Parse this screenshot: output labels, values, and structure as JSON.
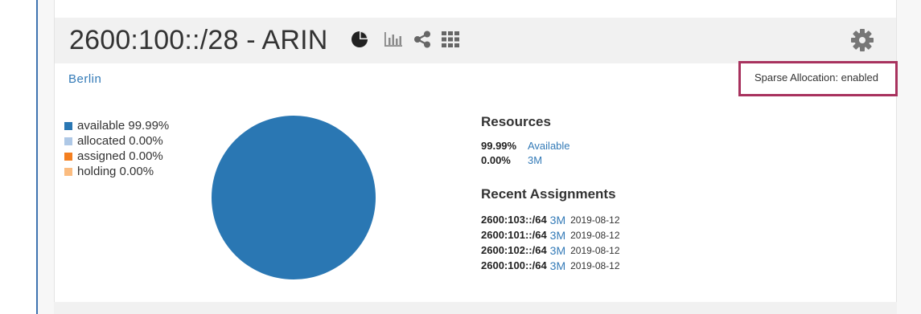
{
  "panel": {
    "title": "2600:100::/28 - ARIN",
    "location_link": "Berlin",
    "sparse_allocation": "Sparse Allocation: enabled",
    "header_icons": [
      "pie-chart-icon",
      "bar-chart-icon",
      "share-icon",
      "grid-icon",
      "gear-icon"
    ]
  },
  "legend": [
    {
      "label": "available 99.99%",
      "color": "#2a77b3"
    },
    {
      "label": "allocated 0.00%",
      "color": "#aec8e6"
    },
    {
      "label": "assigned 0.00%",
      "color": "#f47f20"
    },
    {
      "label": "holding 0.00%",
      "color": "#fbbc80"
    }
  ],
  "chart_data": {
    "type": "pie",
    "labels": [
      "available",
      "allocated",
      "assigned",
      "holding"
    ],
    "values": [
      99.99,
      0.0,
      0.0,
      0.0
    ],
    "colors": [
      "#2a77b3",
      "#aec8e6",
      "#f47f20",
      "#fbbc80"
    ]
  },
  "resources": {
    "title": "Resources",
    "rows": [
      {
        "pct": "99.99%",
        "label": "Available"
      },
      {
        "pct": "0.00%",
        "label": "3M"
      }
    ]
  },
  "recent": {
    "title": "Recent Assignments",
    "rows": [
      {
        "prefix": "2600:103::/64",
        "org": "3M",
        "date": "2019-08-12"
      },
      {
        "prefix": "2600:101::/64",
        "org": "3M",
        "date": "2019-08-12"
      },
      {
        "prefix": "2600:102::/64",
        "org": "3M",
        "date": "2019-08-12"
      },
      {
        "prefix": "2600:100::/64",
        "org": "3M",
        "date": "2019-08-12"
      }
    ]
  }
}
